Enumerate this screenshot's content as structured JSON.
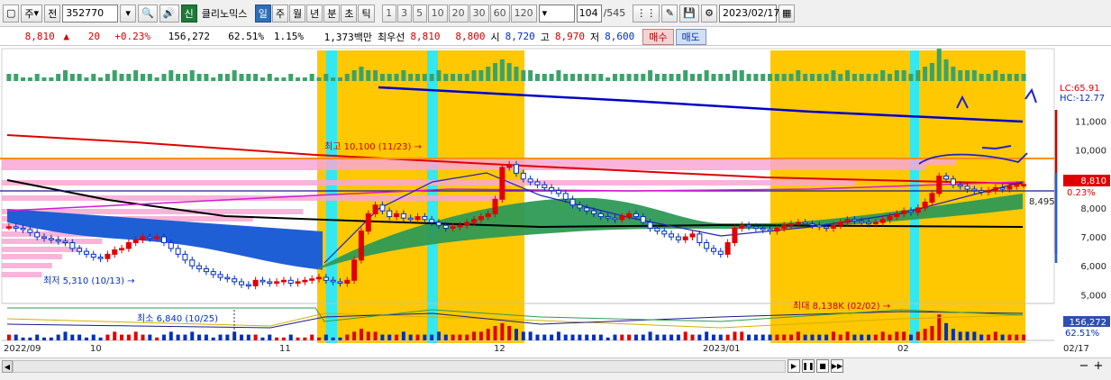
{
  "toolbar": {
    "type_label": "주",
    "prev_label": "전",
    "code": "352770",
    "market_badge": "신",
    "stock_name": "클리노믹스",
    "periods": [
      {
        "label": "일",
        "active": true
      },
      {
        "label": "주",
        "active": false
      },
      {
        "label": "월",
        "active": false
      },
      {
        "label": "년",
        "active": false
      },
      {
        "label": "분",
        "active": false
      },
      {
        "label": "초",
        "active": false
      },
      {
        "label": "틱",
        "active": false
      }
    ],
    "intervals": [
      "1",
      "3",
      "5",
      "10",
      "20",
      "30",
      "60",
      "120"
    ],
    "count_value": "104",
    "count_total": "/545",
    "date": "2023/02/17"
  },
  "info": {
    "price": "8,810",
    "change": "20",
    "change_pct": "+0.23%",
    "volume": "156,272",
    "ratio1": "62.51%",
    "ratio2": "1.15%",
    "amount": "1,373백만",
    "best_bid_label": "최우선",
    "best_bid": "8,810",
    "best_ask": "8,800",
    "open_label": "시",
    "open": "8,720",
    "high_label": "고",
    "high": "8,970",
    "low_label": "저",
    "low": "8,600",
    "buy_label": "매수",
    "sell_label": "매도"
  },
  "chart_data": {
    "type": "candlestick",
    "y_ticks": [
      "11,000",
      "10,000",
      "9,000",
      "8,000",
      "7,000",
      "6,000",
      "5,000"
    ],
    "x_labels": [
      "2022/09",
      "10",
      "11",
      "12",
      "2023/01",
      "02",
      "02/17"
    ],
    "annotations": {
      "high": "최고 10,100 (11/23)",
      "low": "최저 5,310 (10/13)",
      "vol_min": "최소 6,840 (10/25)",
      "vol_max": "최대 8,138K (02/02)"
    },
    "right_labels": {
      "lc": "LC:65.91",
      "hc": "HC:-12.77",
      "current_price": "8,810",
      "current_pct": "0.23%",
      "line_value": "8,495",
      "volume": "156,272",
      "vol_pct": "62.51%"
    },
    "closes": [
      7350,
      7300,
      7250,
      7150,
      7000,
      6950,
      6900,
      6850,
      6800,
      6600,
      6500,
      6400,
      6300,
      6250,
      6400,
      6550,
      6600,
      6800,
      6900,
      7000,
      6950,
      7000,
      6800,
      6600,
      6400,
      6200,
      6000,
      5900,
      5800,
      5700,
      5600,
      5550,
      5450,
      5350,
      5310,
      5500,
      5450,
      5400,
      5450,
      5500,
      5400,
      5450,
      5500,
      5550,
      5600,
      5500,
      5450,
      5400,
      5500,
      6200,
      7200,
      7800,
      8100,
      7900,
      7700,
      7800,
      7650,
      7600,
      7700,
      7600,
      7500,
      7400,
      7300,
      7350,
      7400,
      7500,
      7600,
      7700,
      7800,
      8300,
      9400,
      9500,
      9200,
      9000,
      8900,
      8800,
      8700,
      8600,
      8500,
      8300,
      8100,
      8000,
      7900,
      7800,
      7700,
      7650,
      7600,
      7700,
      7800,
      7700,
      7500,
      7300,
      7200,
      7100,
      7000,
      6900,
      7000,
      7100,
      6800,
      6600,
      6500,
      6400,
      6800,
      7300,
      7400,
      7350,
      7300,
      7250,
      7200,
      7300,
      7400,
      7450,
      7500,
      7450,
      7400,
      7350,
      7300,
      7400,
      7500,
      7600,
      7550,
      7500,
      7450,
      7500,
      7600,
      7700,
      7800,
      7900,
      7850,
      8000,
      8200,
      8500,
      9100,
      9000,
      8800,
      8750,
      8650,
      8600,
      8550,
      8600,
      8700,
      8650,
      8750,
      8800,
      8810
    ],
    "volumes": [
      2,
      2,
      1,
      1,
      2,
      1,
      1,
      2,
      3,
      2,
      2,
      1,
      2,
      1,
      2,
      3,
      2,
      2,
      3,
      2,
      2,
      1,
      2,
      3,
      2,
      2,
      3,
      2,
      2,
      1,
      2,
      2,
      3,
      2,
      2,
      2,
      1,
      2,
      1,
      1,
      2,
      1,
      1,
      2,
      1,
      2,
      1,
      1,
      2,
      3,
      4,
      3,
      3,
      2,
      2,
      2,
      3,
      2,
      2,
      2,
      2,
      3,
      2,
      2,
      2,
      2,
      3,
      3,
      4,
      5,
      6,
      5,
      4,
      3,
      3,
      2,
      2,
      2,
      3,
      2,
      2,
      2,
      2,
      2,
      2,
      1,
      2,
      2,
      2,
      2,
      2,
      3,
      2,
      2,
      2,
      2,
      3,
      2,
      2,
      3,
      2,
      2,
      2,
      3,
      3,
      2,
      2,
      2,
      2,
      2,
      2,
      2,
      3,
      2,
      2,
      2,
      2,
      3,
      2,
      3,
      2,
      2,
      2,
      2,
      3,
      2,
      3,
      3,
      2,
      3,
      4,
      5,
      9,
      6,
      4,
      3,
      3,
      3,
      2,
      2,
      3,
      2,
      2,
      2,
      2
    ],
    "highlight_ranges": [
      [
        352,
        480
      ],
      [
        480,
        582
      ],
      [
        855,
        1010
      ],
      [
        1010,
        1138
      ]
    ],
    "cyan_bands": [
      [
        362,
        374
      ],
      [
        474,
        486
      ],
      [
        1010,
        1020
      ]
    ]
  },
  "colors": {
    "up": "#e00000",
    "down": "#0030c0",
    "highlight": "#ffc800",
    "cyan": "#33e8f0",
    "ichimoku_green": "#2e9a55",
    "ichimoku_blue": "#1f5fd6"
  },
  "bottom": {
    "nav_buttons": [
      "play-icon",
      "pause-icon",
      "stop-icon",
      "fast-forward-icon"
    ],
    "zoom_minus": "−",
    "zoom_plus": "+"
  }
}
